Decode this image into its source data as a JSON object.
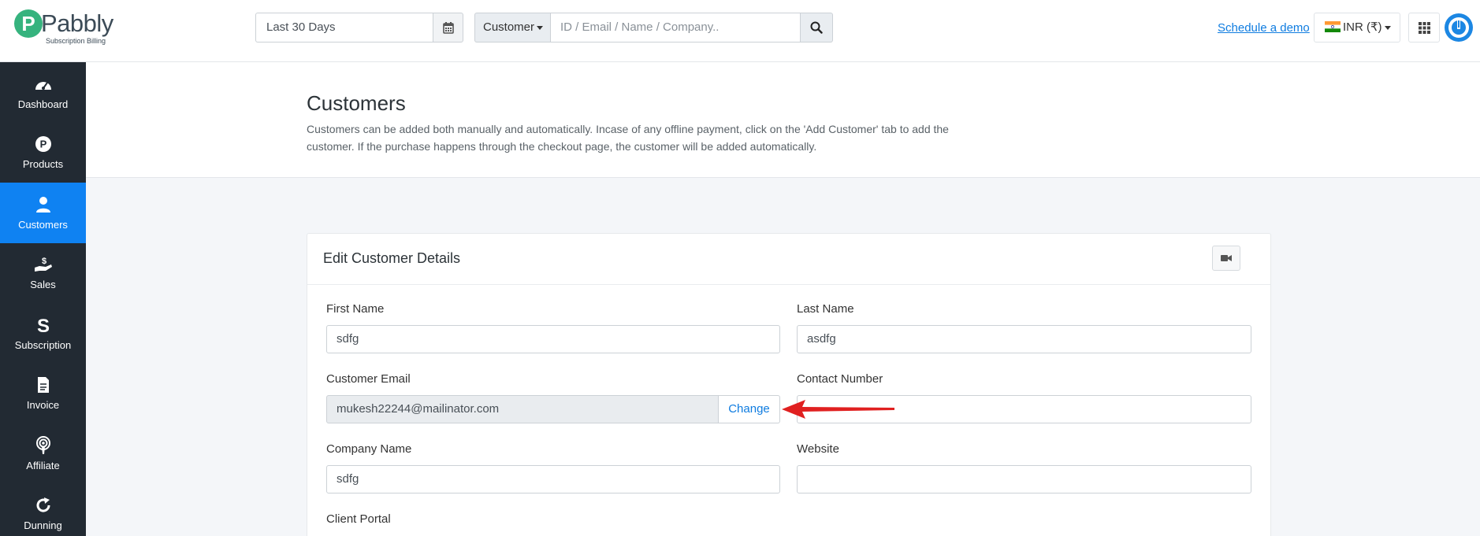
{
  "brand": {
    "logo_letter": "P",
    "name": "Pabbly",
    "tagline": "Subscription Billing"
  },
  "header": {
    "date_range": "Last 30 Days",
    "search_type": "Customer",
    "search_placeholder": "ID / Email / Name / Company..",
    "demo_link": "Schedule a demo",
    "currency": "INR (₹)"
  },
  "sidebar": {
    "items": [
      {
        "label": "Dashboard",
        "icon": "speedometer-icon"
      },
      {
        "label": "Products",
        "icon": "product-p-icon"
      },
      {
        "label": "Customers",
        "icon": "user-icon",
        "active": true
      },
      {
        "label": "Sales",
        "icon": "hand-money-icon"
      },
      {
        "label": "Subscription",
        "icon": "subscription-s-icon"
      },
      {
        "label": "Invoice",
        "icon": "invoice-icon"
      },
      {
        "label": "Affiliate",
        "icon": "broadcast-icon"
      },
      {
        "label": "Dunning",
        "icon": "refresh-icon"
      }
    ]
  },
  "page": {
    "title": "Customers",
    "description": "Customers can be added both manually and automatically. Incase of any offline payment, click on the 'Add Customer' tab to add the customer. If the purchase happens through the checkout page, the customer will be added automatically."
  },
  "form": {
    "title": "Edit Customer Details",
    "first_name_label": "First Name",
    "first_name_value": "sdfg",
    "last_name_label": "Last Name",
    "last_name_value": "asdfg",
    "email_label": "Customer Email",
    "email_value": "mukesh22244@mailinator.com",
    "change_label": "Change",
    "contact_label": "Contact Number",
    "contact_value": "",
    "company_label": "Company Name",
    "company_value": "sdfg",
    "website_label": "Website",
    "website_value": "",
    "portal_label": "Client Portal"
  },
  "colors": {
    "accent": "#0f82f2",
    "sidebar_bg": "#222a33",
    "annotation_arrow": "#e02020"
  }
}
